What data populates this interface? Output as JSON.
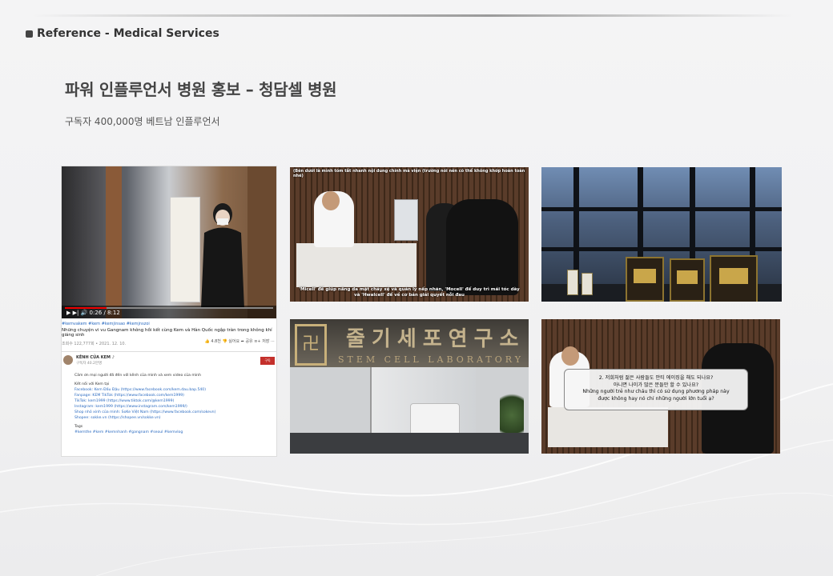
{
  "header": {
    "section_label": "Reference - Medical Services",
    "title": "파워 인플루언서 병원 홍보 – 청담셀 병원",
    "subtitle": "구독자 400,000명 베트남 인플루언서"
  },
  "youtube": {
    "time": "0:26 / 8:12",
    "tags": "#kemvakem #kem #kemjinsao #kemjnszoi",
    "video_title": "Những chuyện vi vu Gangnam không hồi kết cùng Kem và Hàn Quốc ngập tràn trong không khí giáng sinh",
    "views": "조회수 122,777회 • 2021. 12. 10.",
    "actions": "👍 4.8천   👎 싫어요   ➦ 공유   ≡+ 저장   ⋯",
    "channel_name": "KÊNH CỦA KEM ♪",
    "channel_subs": "구독자 40.2만명",
    "subscribe": "구독",
    "description": [
      "Cảm ơn mọi người đã đến với kênh của mình và xem video của mình",
      "Kết nối với Kem tại",
      "Facebook: Kem Đấu Đậu (https://www.facebook.com/kem.dau.bap.540)",
      "Fanpage: KEM TikTok (https://www.facebook.com/kem1999)",
      "TikTok: kem1999 (https://www.tiktok.com/@kem1999)",
      "Instagram: kem1999 (https://www.instagram.com/kem1999/)",
      "Shop nhỏ xinh của mình: SoKe Việt Nam (https://www.facebook.com/sokevn)",
      "Shopee: sokke.vn (https://shopee.vn/sokke.vn)",
      "Tags",
      "#kemthe #kem #kemnhanh #gangnam #seoul #kemvlog"
    ]
  },
  "consult": {
    "top_subtitle": "(Bên dưới là mình tóm tắt nhanh nội dung chính mà viện (trường nói nên có thể không khớp hoàn toàn nhé)",
    "bottom_subtitle_1": "'Micell' để giúp nâng da mặt chảy xệ và quản lý nếp nhăn, 'Mocell' để duy trì mái tóc dày",
    "bottom_subtitle_2": "và 'Hwalcell' để về cơ bản giải quyết nỗi đau"
  },
  "lab": {
    "sign": "줄기세포연구소",
    "sign_en": "STEM CELL LABORATORY",
    "emblem": "卍"
  },
  "consult2": {
    "q1": "2. 저희처럼 젊은 사람들도 안티 에이징을 해도 되나요?",
    "q2": "아니면 나이가 많은 분들만 할 수 있나요?",
    "q3": "Những người trẻ như cháu thì có sử dụng phương pháp này",
    "q4": "được không hay nó chỉ những người lớn tuổi ạ?"
  },
  "colors": {
    "background": "#f1f1f2",
    "text": "#333333",
    "yt_red": "#c4302b",
    "link_blue": "#2a6ac0"
  }
}
